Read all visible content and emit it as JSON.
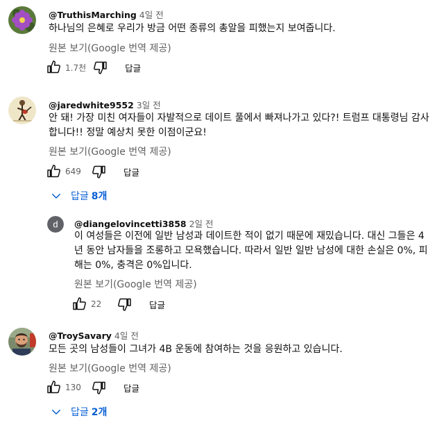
{
  "comments": [
    {
      "handle": "@TruthisMarching",
      "time": "4일 전",
      "text": "하나님의 은혜로 우리가 방금 어떤 종류의 총알을 피했는지 보여줍니다.",
      "translate": "원본 보기(Google 번역 제공)",
      "likes": "1.7천",
      "reply": "답글",
      "avatar_icon": "purple-flower-avatar"
    },
    {
      "handle": "@jaredwhite9552",
      "time": "3일 전",
      "text": "안 돼!  가장 미친 여자들이 자발적으로 데이트 풀에서 빠져나가고 있다?!  트럼프 대통령님 감사합니다!!  정말 예상치 못한 이점이군요!",
      "translate": "원본 보기(Google 번역 제공)",
      "likes": "649",
      "reply": "답글",
      "replies_label": "답글",
      "replies_count": "8개",
      "avatar_icon": "guitar-player-avatar"
    },
    {
      "handle": "@diangelovincetti3858",
      "time": "2일 전",
      "text": "이 여성들은 이전에 일반 남성과 데이트한 적이 없기 때문에 재밌습니다. 대신 그들은 4년 동안 남자들을 조롱하고 모욕했습니다. 따라서 일반 일반 남성에 대한 손실은 0%, 피해는 0%, 충격은 0%입니다.",
      "translate": "원본 보기(Google 번역 제공)",
      "likes": "22",
      "reply": "답글",
      "avatar_letter": "d",
      "avatar_color": "#5f6368"
    },
    {
      "handle": "@TroySavary",
      "time": "4일 전",
      "text": "모든 곳의 남성들이 그녀가 4B 운동에 참여하는 것을 응원하고 있습니다.",
      "translate": "원본 보기(Google 번역 제공)",
      "likes": "130",
      "reply": "답글",
      "replies_label": "답글",
      "replies_count": "2개",
      "avatar_icon": "bearded-man-avatar"
    }
  ],
  "colors": {
    "link_blue": "#065fd4",
    "secondary_text": "#606060"
  }
}
